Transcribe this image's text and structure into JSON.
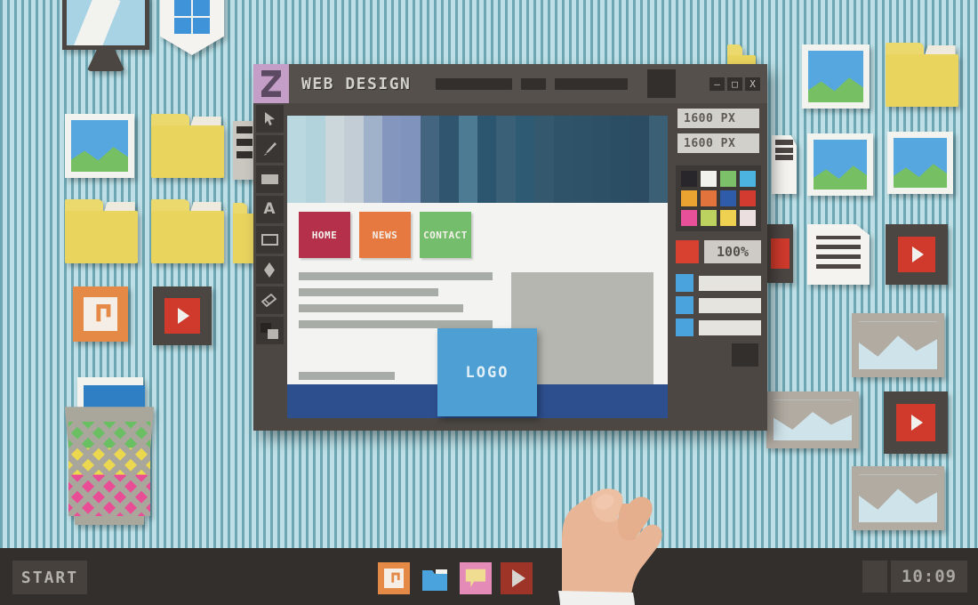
{
  "app": {
    "title": "WEB DESIGN",
    "logo_icon": "app-logo-icon",
    "window_controls": {
      "minimize": "—",
      "maximize": "□",
      "close": "X"
    }
  },
  "toolbar": {
    "tools": [
      {
        "name": "cursor-tool",
        "icon": "cursor-icon"
      },
      {
        "name": "brush-tool",
        "icon": "brush-icon"
      },
      {
        "name": "fill-rectangle-tool",
        "icon": "filled-rectangle-icon"
      },
      {
        "name": "text-tool",
        "icon": "text-a-icon",
        "glyph": "A"
      },
      {
        "name": "rectangle-tool",
        "icon": "rectangle-outline-icon"
      },
      {
        "name": "shape-tool",
        "icon": "diamond-icon"
      },
      {
        "name": "eraser-tool",
        "icon": "eraser-icon"
      },
      {
        "name": "color-picker-tool",
        "icon": "color-swatch-icon"
      }
    ]
  },
  "canvas": {
    "nav_buttons": [
      {
        "label": "HOME",
        "color": "#b5304a"
      },
      {
        "label": "NEWS",
        "color": "#e5793f"
      },
      {
        "label": "CONTACT",
        "color": "#74bd6c"
      }
    ],
    "banner_colors": [
      "#b9d8e0",
      "#b2d3dc",
      "#cbd7da",
      "#c3cdd6",
      "#9fb2c9",
      "#8496be",
      "#7f93bd",
      "#44657f",
      "#30566f",
      "#4d7b93",
      "#2c5570",
      "#3a6078",
      "#2f5a73",
      "#34596f",
      "#2f5469",
      "#2e5268",
      "#2d5066",
      "#2c4e64",
      "#2b4c62",
      "#3b5f74"
    ],
    "text_bar_widths": [
      "100%",
      "72%",
      "85%",
      "100%"
    ],
    "footer_color": "#2d4f8e",
    "image_placeholder_color": "#b5b6b0"
  },
  "logo_card": {
    "label": "LOGO",
    "color": "#4d9fd4"
  },
  "properties": {
    "width_field": "1600 PX",
    "height_field": "1600 PX",
    "zoom_level": "100%",
    "active_color": "#d8412f",
    "swatches": [
      "#28262a",
      "#f1f1ee",
      "#7cc06a",
      "#4cb3e0",
      "#eaa331",
      "#e2733c",
      "#2f5ca8",
      "#d33a30",
      "#e8509a",
      "#bcd45f",
      "#efd152",
      "#ecdfe0"
    ],
    "layers": [
      {
        "name": "layer-row-1"
      },
      {
        "name": "layer-row-2"
      },
      {
        "name": "layer-row-3"
      }
    ]
  },
  "taskbar": {
    "start_label": "START",
    "clock": "10:09",
    "icons": [
      {
        "name": "music-taskbar-icon",
        "color": "#e58947"
      },
      {
        "name": "folder-taskbar-icon",
        "color": "#4aa3dd"
      },
      {
        "name": "chat-taskbar-icon",
        "color": "#e58bb8"
      },
      {
        "name": "video-taskbar-icon",
        "color": "#b33a2c"
      }
    ]
  },
  "desktop": {
    "icons": [
      {
        "name": "monitor-icon",
        "type": "monitor"
      },
      {
        "name": "shield-window-icon",
        "type": "shield"
      },
      {
        "name": "image-file-icon",
        "type": "thumb"
      },
      {
        "name": "folder-icon",
        "type": "folder"
      },
      {
        "name": "music-file-icon",
        "type": "music"
      },
      {
        "name": "video-file-icon",
        "type": "video"
      },
      {
        "name": "document-file-icon",
        "type": "doc"
      },
      {
        "name": "landscape-image-icon",
        "type": "landscape"
      },
      {
        "name": "recycle-bin-icon",
        "type": "bin"
      }
    ]
  }
}
